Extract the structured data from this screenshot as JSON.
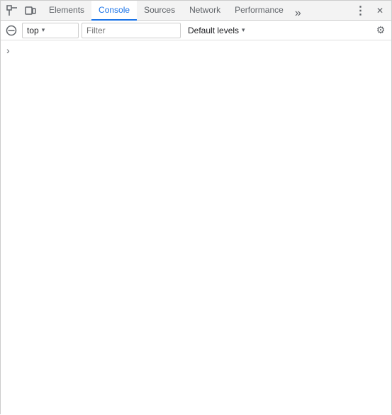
{
  "tabs": {
    "items": [
      {
        "id": "elements",
        "label": "Elements",
        "active": false
      },
      {
        "id": "console",
        "label": "Console",
        "active": true
      },
      {
        "id": "sources",
        "label": "Sources",
        "active": false
      },
      {
        "id": "network",
        "label": "Network",
        "active": false
      },
      {
        "id": "performance",
        "label": "Performance",
        "active": false
      }
    ],
    "overflow_label": "»"
  },
  "toolbar": {
    "context_value": "top",
    "filter_placeholder": "Filter",
    "levels_label": "Default levels",
    "settings_icon": "⚙",
    "chevron": "▾"
  },
  "console": {
    "expand_arrow": "›"
  },
  "icons": {
    "inspect": "⬚",
    "device": "▭",
    "no_entry": "🚫",
    "three_dots": "⋮",
    "close": "✕",
    "gear": "⚙"
  },
  "colors": {
    "active_tab": "#1a73e8",
    "tab_bar_bg": "#f3f3f3",
    "border": "#ccc"
  }
}
